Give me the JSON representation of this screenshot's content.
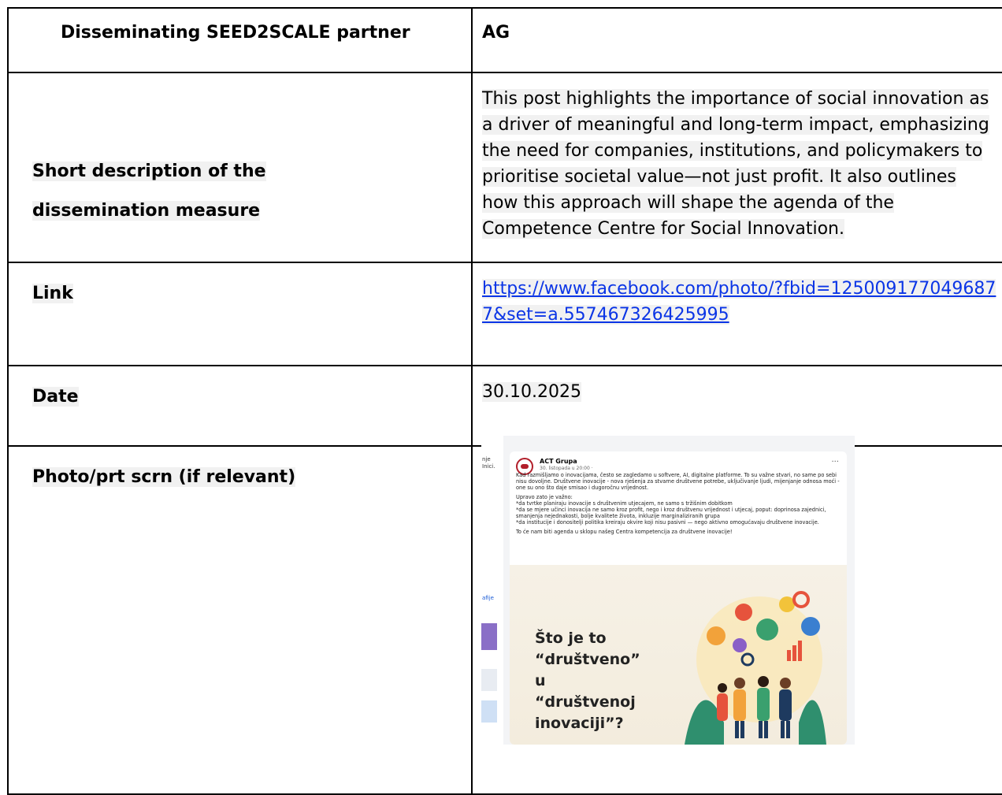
{
  "rows": [
    {
      "label": "Disseminating SEED2SCALE partner",
      "value": "AG"
    },
    {
      "label_lines": [
        "Short description of the",
        "dissemination measure"
      ],
      "value_lines": [
        "This post highlights the importance of social innovation as",
        "a driver of meaningful and long-term impact, emphasizing",
        "the need for companies, institutions, and policymakers to",
        "prioritise societal value—not just profit. It also outlines",
        "how this approach will shape the agenda of the",
        "Competence Centre for Social Innovation."
      ]
    },
    {
      "label": "Link",
      "link": "https://www.facebook.com/photo/?fbid=1250091770496877&set=a.557467326425995"
    },
    {
      "label": "Date",
      "value": "30.10.2025"
    },
    {
      "label": "Photo/prt scrn (if relevant)"
    }
  ],
  "screenshot": {
    "side_texts": [
      "nje",
      "Inici.",
      "afije"
    ],
    "page_name": "ACT Grupa",
    "post_date": "30. listopada u 20:00 ·",
    "more": "···",
    "paragraphs": [
      "Kad razmišljamo o inovacijama, često se zagledamo u softvere, AI, digitalne platforme. To su važne stvari, no same po sebi nisu dovoljne. Društvene inovacije - nova rješenja za stvarne društvene potrebe, uključivanje ljudi, mijenjanje odnosa moći - one su ono što daje smisao i dugoročnu vrijednost.",
      "Upravo zato je važno:\n*da tvrtke planiraju inovacije s društvenim utjecajem, ne samo s tržišnim dobitkom\n*da se mjere učinci inovacija ne samo kroz profit, nego i kroz društvenu vrijednost i utjecaj, poput: doprinosa zajednici, smanjenja nejednakosti, bolje kvalitete života, inkluzije marginaliziranih grupa\n*da institucije i donositelji politika kreiraju okvire koji nisu pasivni — nego aktivno omogućavaju društvene inovacije.",
      "To će nam biti agenda u sklopu našeg Centra kompetencija za društvene inovacije!"
    ],
    "image_headline_lines": [
      "Što je to",
      "“društveno”",
      "u",
      "“društvenoj",
      "inovaciji”?"
    ]
  }
}
